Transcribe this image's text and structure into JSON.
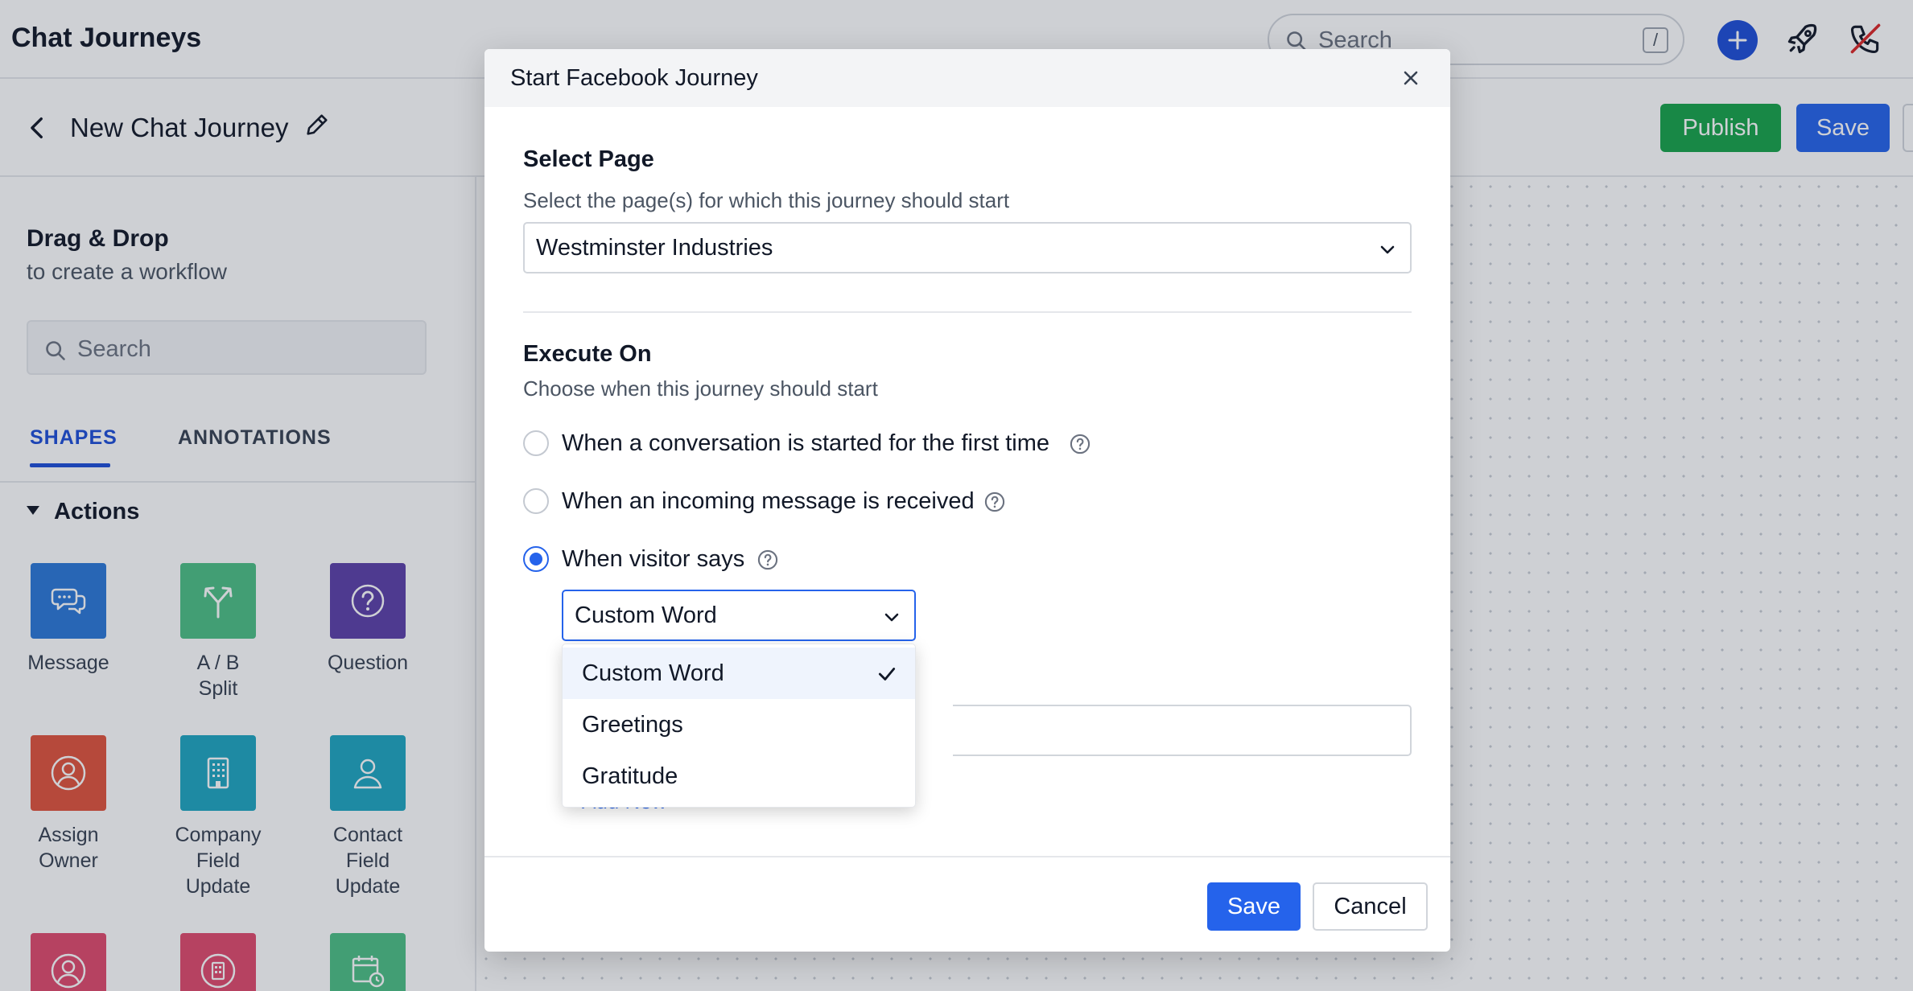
{
  "app": {
    "title": "Chat Journeys"
  },
  "topbar": {
    "search_placeholder": "Search",
    "search_shortcut": "/"
  },
  "subheader": {
    "journey_name": "New Chat Journey",
    "publish_label": "Publish",
    "save_label": "Save"
  },
  "sidebar": {
    "title": "Drag & Drop",
    "subtitle": "to create a workflow",
    "search_placeholder": "Search",
    "tabs": [
      {
        "label": "SHAPES"
      },
      {
        "label": "ANNOTATIONS"
      }
    ],
    "section_label": "Actions",
    "shapes": [
      {
        "label": "Message",
        "color": "#2b78d8"
      },
      {
        "label": "A / B\nSplit",
        "color": "#4cbf85"
      },
      {
        "label": "Question",
        "color": "#5b3fa8"
      },
      {
        "label": "Assign\nOwner",
        "color": "#e0533c"
      },
      {
        "label": "Company\nField\nUpdate",
        "color": "#1ea6c0"
      },
      {
        "label": "Contact\nField\nUpdate",
        "color": "#1ea6c0"
      },
      {
        "label": "",
        "color": "#e04a6c"
      },
      {
        "label": "",
        "color": "#e04a6c"
      },
      {
        "label": "",
        "color": "#4cbf85"
      }
    ]
  },
  "modal": {
    "title": "Start Facebook Journey",
    "select_page_label": "Select Page",
    "select_page_help": "Select the page(s) for which this journey should start",
    "selected_page": "Westminster Industries",
    "execute_on_label": "Execute On",
    "execute_on_help": "Choose when this journey should start",
    "options": [
      {
        "label": "When a conversation is started for the first time",
        "checked": false
      },
      {
        "label": "When an incoming message is received",
        "checked": false
      },
      {
        "label": "When visitor says",
        "checked": true
      }
    ],
    "visitor_says_value": "Custom Word",
    "add_new_label": "+ Add New",
    "save_label": "Save",
    "cancel_label": "Cancel"
  },
  "dropdown": {
    "items": [
      {
        "label": "Custom Word",
        "selected": true
      },
      {
        "label": "Greetings",
        "selected": false
      },
      {
        "label": "Gratitude",
        "selected": false
      }
    ]
  },
  "colors": {
    "primary": "#2563eb",
    "publish": "#16a34a"
  }
}
